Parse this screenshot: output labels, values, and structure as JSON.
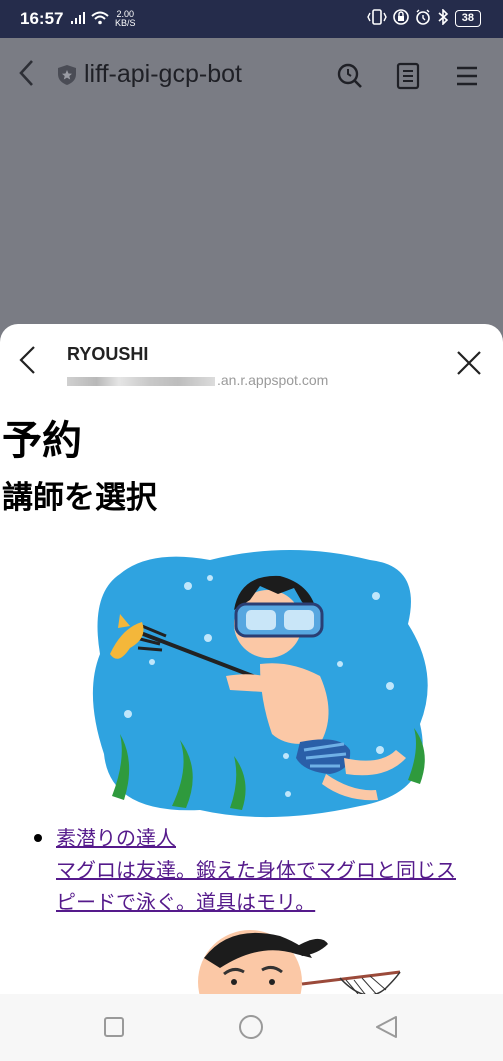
{
  "status": {
    "time": "16:57",
    "net_speed_value": "2.00",
    "net_speed_unit": "KB/S",
    "battery": "38"
  },
  "appbar": {
    "title": "liff-api-gcp-bot",
    "icons": [
      "back-icon",
      "shield-icon",
      "search-icon",
      "document-icon",
      "menu-icon"
    ]
  },
  "sheet": {
    "name": "RYOUSHI",
    "url_visible": ".an.r.appspot.com"
  },
  "page": {
    "heading": "予約",
    "subheading": "講師を選択",
    "instructors": [
      {
        "name": "素潜りの達人",
        "desc_line1": "マグロは友達。鍛えた身体でマグロと同じス",
        "desc_line2": "ピードで泳ぐ。道具はモリ。"
      }
    ]
  },
  "navbar": {
    "icons": [
      "square-icon",
      "circle-icon",
      "triangle-back-icon"
    ]
  },
  "colors": {
    "statusbar": "#252c4b",
    "overlay": "#7a7c84",
    "link": "#551a8b",
    "water": "#2fa3e0"
  }
}
